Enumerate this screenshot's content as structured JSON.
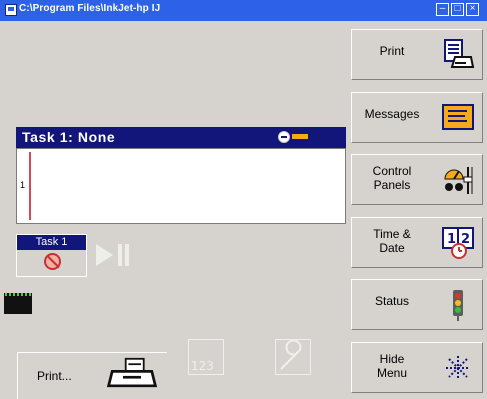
{
  "window": {
    "title": "C:\\Program Files\\InkJet-hp   IJ",
    "minimize_icon": "minimize-icon",
    "maximize_icon": "maximize-icon",
    "close_icon": "close-icon"
  },
  "task": {
    "header": "Task 1: None",
    "remove_icon": "remove-icon",
    "message_line_number": "1",
    "button_label": "Task 1",
    "button_icon": "no-print-icon"
  },
  "playback": {
    "play_icon": "play-icon",
    "pause_icon": "pause-icon"
  },
  "side_buttons": [
    {
      "label": "Print",
      "icon": "printer-icon"
    },
    {
      "label": "Messages",
      "icon": "message-icon"
    },
    {
      "label_line1": "Control",
      "label_line2": "Panels",
      "icon": "control-panel-icon"
    },
    {
      "label_line1": "Time &",
      "label_line2": "Date",
      "icon": "calendar-clock-icon"
    },
    {
      "label": "Status",
      "icon": "status-light-icon"
    },
    {
      "label_line1": "Hide",
      "label_line2": "Menu",
      "icon": "hide-menu-icon"
    }
  ],
  "bottom_buttons": {
    "print_label": "Print...",
    "print_icon": "printer-icon",
    "counter_icon": "counter-icon",
    "wrench_icon": "wrench-icon"
  },
  "colors": {
    "titlebar": "#2d61e7",
    "task_header": "#12157a",
    "accent_orange": "#f8a81b",
    "accent_red": "#c83034",
    "ink_green": "#30e030"
  }
}
